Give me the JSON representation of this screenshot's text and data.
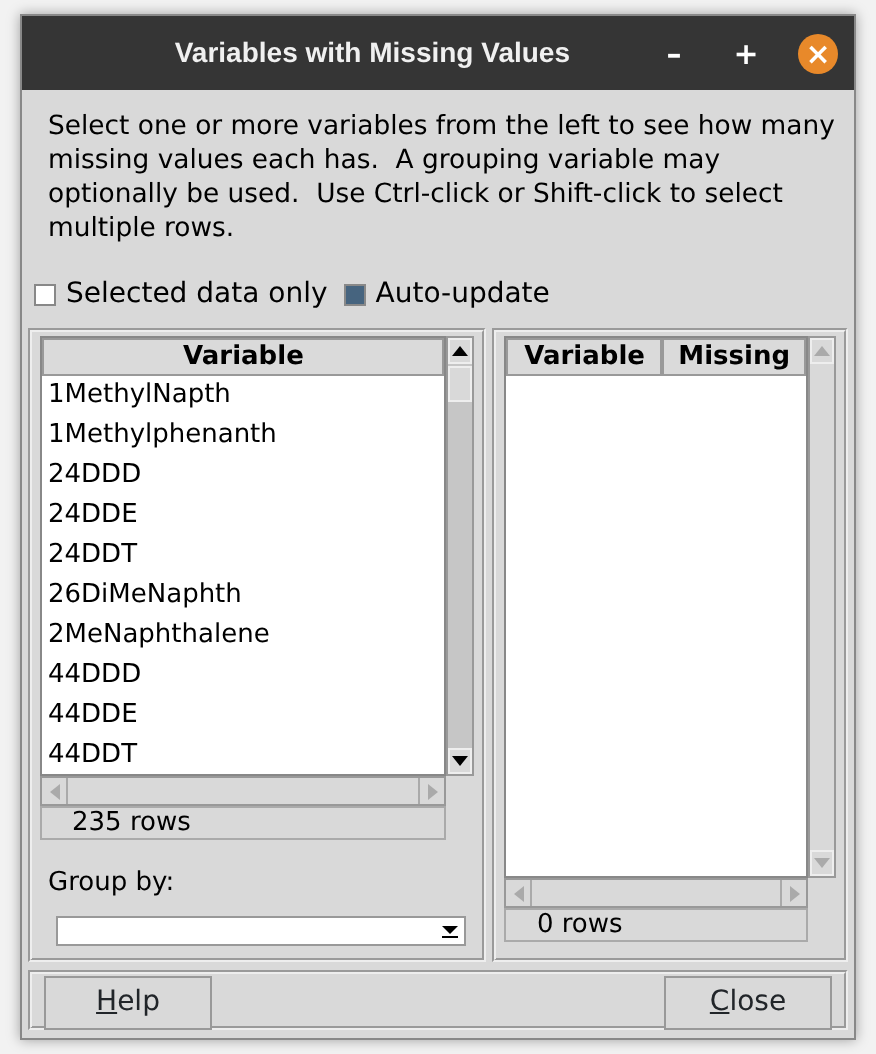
{
  "window": {
    "title": "Variables with Missing Values",
    "controls": [
      "–",
      "+",
      "×"
    ]
  },
  "description": "Select one or more variables from the left to see how many missing values each has.  A grouping variable may optionally be used.  Use Ctrl-click or Shift-click to select multiple rows.",
  "options": [
    {
      "label": "Selected data only",
      "checked": false
    },
    {
      "label": "Auto-update",
      "checked": true
    }
  ],
  "variable_list": {
    "columns": [
      "Variable"
    ],
    "rows": [
      "1MethylNapth",
      "1Methylphenanth",
      "24DDD",
      "24DDE",
      "24DDT",
      "26DiMeNaphth",
      "2MeNaphthalene",
      "44DDD",
      "44DDE",
      "44DDT"
    ],
    "status": "235 rows"
  },
  "group_by": {
    "label": "Group by:"
  },
  "results": {
    "columns": [
      "Variable",
      "Missing"
    ],
    "status": "0 rows"
  },
  "buttons": [
    {
      "label": "Help",
      "mnemonic": true
    },
    {
      "label": "Close",
      "mnemonic": true
    }
  ]
}
